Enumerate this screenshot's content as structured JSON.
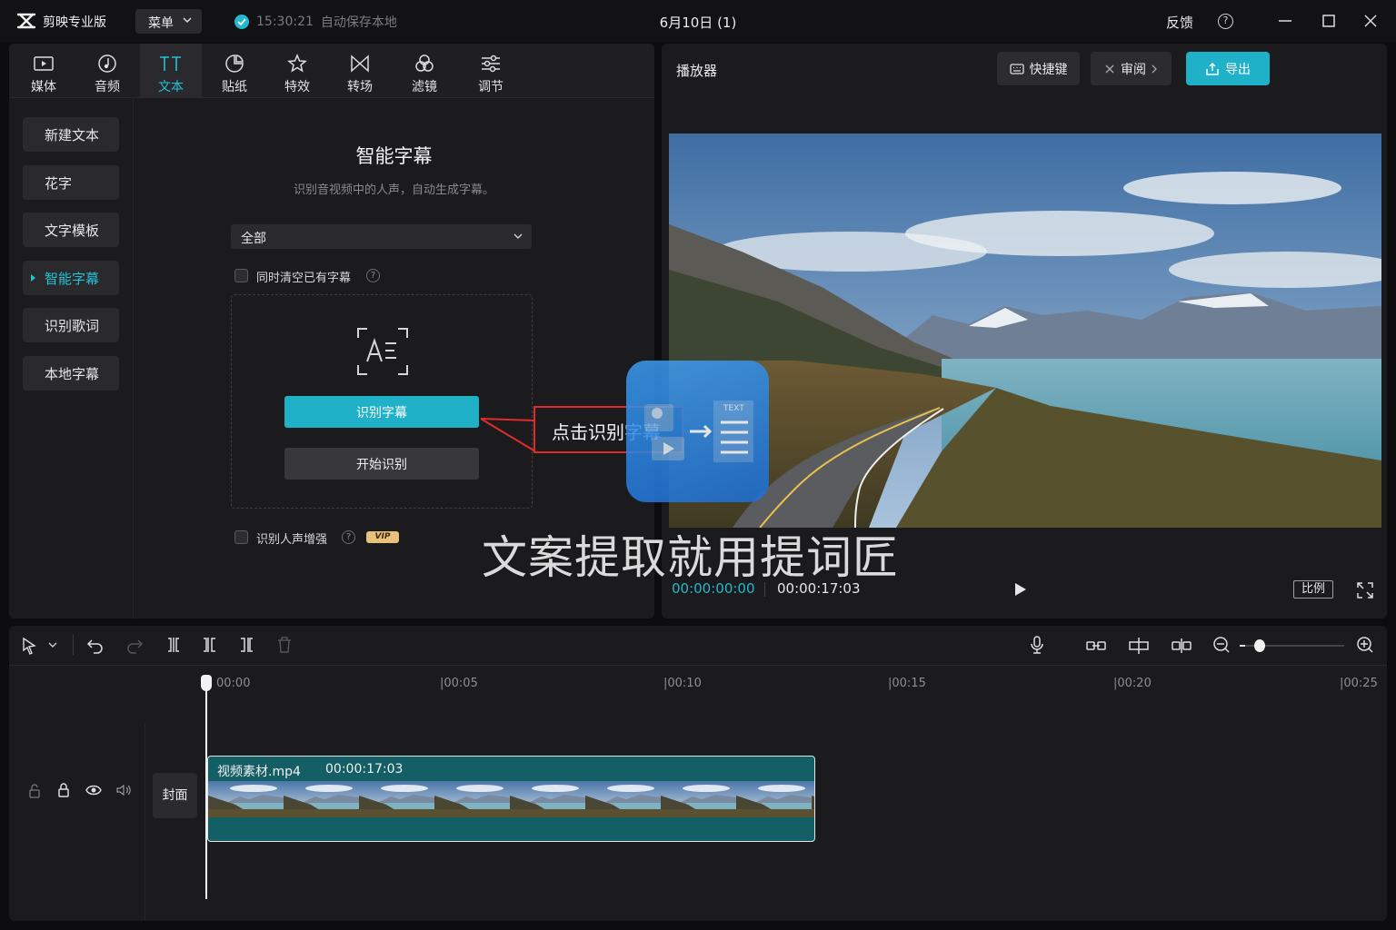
{
  "titlebar": {
    "app_name": "剪映专业版",
    "menu_label": "菜单",
    "save_time": "15:30:21",
    "save_status": "自动保存本地",
    "doc_title": "6月10日 (1)",
    "feedback": "反馈",
    "help": "?"
  },
  "tabs": [
    {
      "label": "媒体",
      "icon": "media-icon"
    },
    {
      "label": "音频",
      "icon": "audio-icon"
    },
    {
      "label": "文本",
      "icon": "text-icon",
      "active": true
    },
    {
      "label": "贴纸",
      "icon": "sticker-icon"
    },
    {
      "label": "特效",
      "icon": "effects-icon"
    },
    {
      "label": "转场",
      "icon": "transition-icon"
    },
    {
      "label": "滤镜",
      "icon": "filter-icon"
    },
    {
      "label": "调节",
      "icon": "adjust-icon"
    }
  ],
  "sidebar": {
    "items": [
      {
        "label": "新建文本"
      },
      {
        "label": "花字"
      },
      {
        "label": "文字模板"
      },
      {
        "label": "智能字幕",
        "active": true
      },
      {
        "label": "识别歌词"
      },
      {
        "label": "本地字幕"
      }
    ]
  },
  "subtitle_panel": {
    "title": "智能字幕",
    "subtitle": "识别音视频中的人声，自动生成字幕。",
    "language_selected": "全部",
    "clear_existing_label": "同时清空已有字幕",
    "recognize_button": "识别字幕",
    "start_button": "开始识别",
    "voice_enhance_label": "识别人声增强",
    "vip_badge": "VIP"
  },
  "player": {
    "title": "播放器",
    "shortcut_label": "快捷键",
    "review_label": "审阅",
    "export_label": "导出",
    "current_time": "00:00:00:00",
    "total_time": "00:00:17:03",
    "ratio_label": "比例"
  },
  "timeline": {
    "ruler": [
      "00:00",
      "|00:05",
      "|00:10",
      "|00:15",
      "|00:20",
      "|00:25"
    ],
    "cover_label": "封面",
    "clip": {
      "name": "视频素材.mp4",
      "duration": "00:00:17:03"
    },
    "zoom_level": 0.05
  },
  "overlay": {
    "callout": "点击识别字幕",
    "watermark_text": "文案提取就用提词匠",
    "watermark_icon_label": "TEXT"
  },
  "colors": {
    "accent": "#1fb1c8",
    "callout_border": "#e02b2b",
    "panel": "#1b1b1e",
    "background": "#0d0d0f"
  }
}
